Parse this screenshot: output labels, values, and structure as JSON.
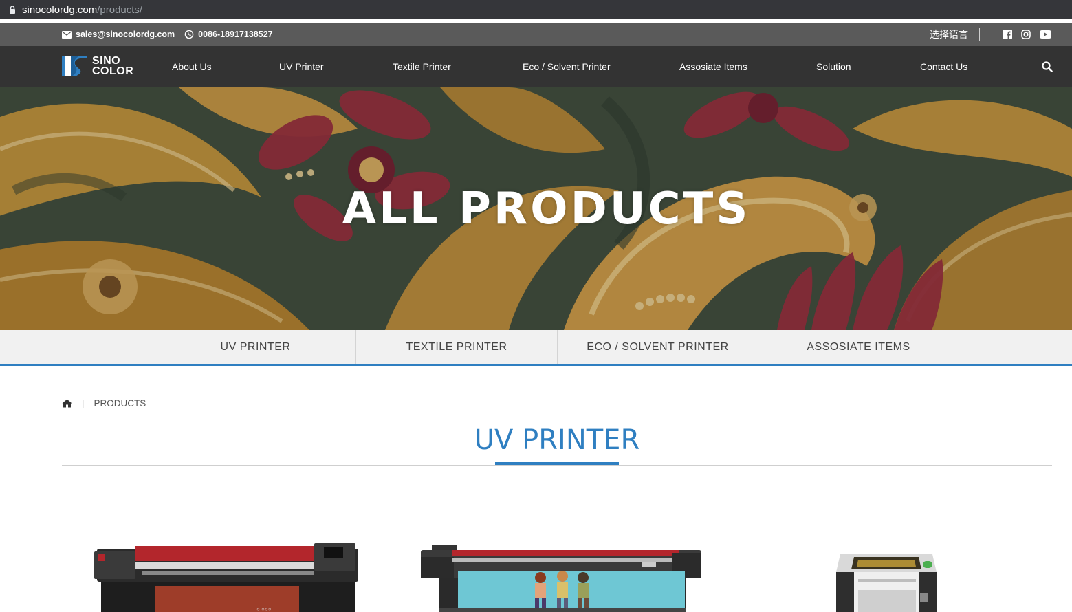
{
  "browser": {
    "url_domain": "sinocolordg.com",
    "url_path": "/products/"
  },
  "topbar": {
    "email": "sales@sinocolordg.com",
    "phone": "0086-18917138527",
    "language": "选择语言",
    "social_icons": [
      "facebook-icon",
      "instagram-icon",
      "youtube-icon"
    ]
  },
  "logo": {
    "line1": "SINO",
    "line2": "COLOR"
  },
  "nav": {
    "items": [
      {
        "label": "About Us"
      },
      {
        "label": "UV Printer"
      },
      {
        "label": "Textile Printer"
      },
      {
        "label": "Eco / Solvent Printer"
      },
      {
        "label": "Assosiate Items"
      },
      {
        "label": "Solution"
      },
      {
        "label": "Contact Us"
      }
    ],
    "search_icon": "search-icon"
  },
  "hero": {
    "title": "ALL PRODUCTS"
  },
  "categories": {
    "tabs": [
      {
        "label": "UV PRINTER"
      },
      {
        "label": "TEXTILE PRINTER"
      },
      {
        "label": "ECO / SOLVENT PRINTER"
      },
      {
        "label": "ASSOSIATE ITEMS"
      }
    ]
  },
  "breadcrumb": {
    "home_icon": "home-icon",
    "separator": "|",
    "current": "PRODUCTS"
  },
  "section": {
    "title": "UV PRINTER"
  },
  "colors": {
    "accent": "#2f7fc1",
    "nav_bg": "#333333",
    "topbar_bg": "#5a5a5a",
    "tab_bg": "#f1f1f1"
  }
}
